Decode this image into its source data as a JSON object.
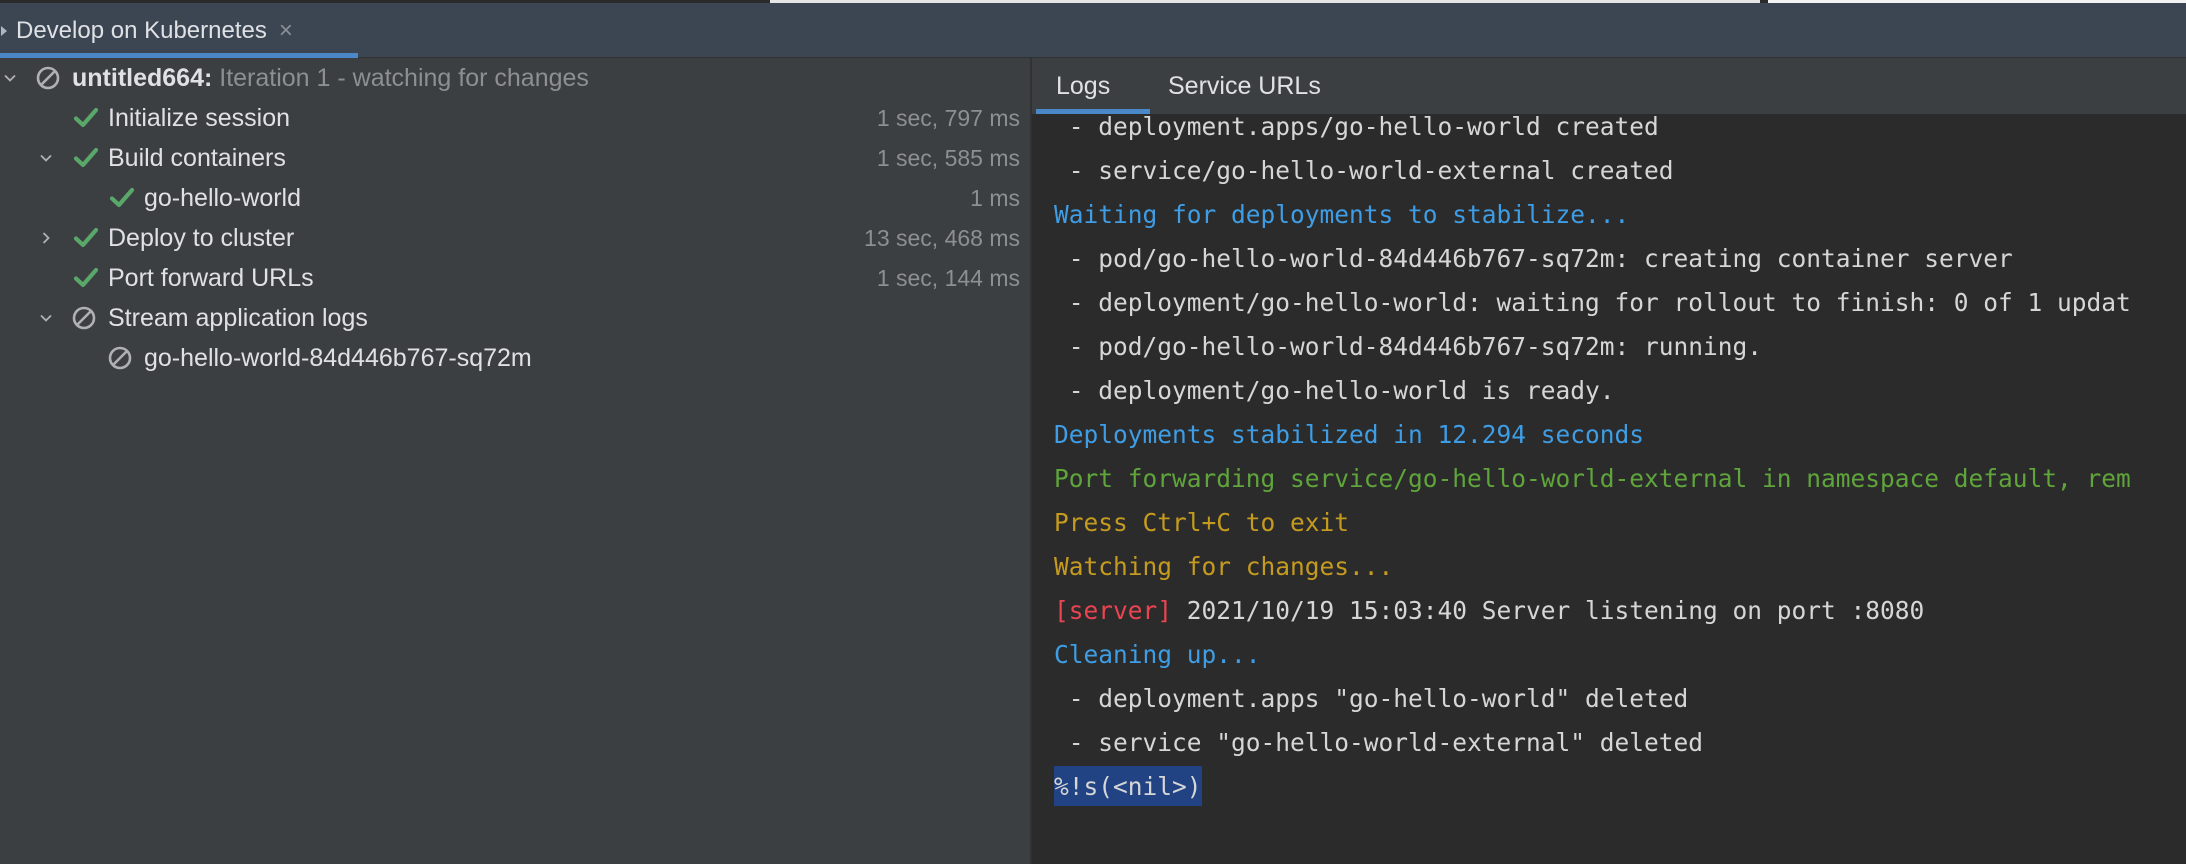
{
  "header": {
    "tab_title": "Develop on Kubernetes",
    "close_glyph": "×"
  },
  "tree": {
    "root": {
      "name": "untitled664:",
      "status": "Iteration 1 - watching for changes",
      "icon": "cancelled-icon"
    },
    "items": [
      {
        "label": "Initialize session",
        "duration": "1 sec, 797 ms",
        "icon": "check-icon"
      },
      {
        "label": "Build containers",
        "duration": "1 sec, 585 ms",
        "icon": "check-icon",
        "expanded": true
      },
      {
        "label": "go-hello-world",
        "duration": "1 ms",
        "icon": "check-icon"
      },
      {
        "label": "Deploy to cluster",
        "duration": "13 sec, 468 ms",
        "icon": "check-icon",
        "expanded": false
      },
      {
        "label": "Port forward URLs",
        "duration": "1 sec, 144 ms",
        "icon": "check-icon"
      },
      {
        "label": "Stream application logs",
        "duration": "",
        "icon": "cancelled-icon",
        "expanded": true
      },
      {
        "label": "go-hello-world-84d446b767-sq72m",
        "duration": "",
        "icon": "cancelled-icon"
      }
    ]
  },
  "log_tabs": {
    "logs": "Logs",
    "service_urls": "Service URLs"
  },
  "console": {
    "lines": [
      {
        "text": " - deployment.apps/go-hello-world created",
        "color": "white"
      },
      {
        "text": " - service/go-hello-world-external created",
        "color": "white"
      },
      {
        "text": "Waiting for deployments to stabilize...",
        "color": "blue"
      },
      {
        "text": " - pod/go-hello-world-84d446b767-sq72m: creating container server",
        "color": "white"
      },
      {
        "text": " - deployment/go-hello-world: waiting for rollout to finish: 0 of 1 updat",
        "color": "white"
      },
      {
        "text": " - pod/go-hello-world-84d446b767-sq72m: running.",
        "color": "white"
      },
      {
        "text": " - deployment/go-hello-world is ready.",
        "color": "white"
      },
      {
        "text": "Deployments stabilized in 12.294 seconds",
        "color": "blue"
      },
      {
        "text": "Port forwarding service/go-hello-world-external in namespace default, rem",
        "color": "green"
      },
      {
        "text": "Press Ctrl+C to exit",
        "color": "yellow"
      },
      {
        "text": "Watching for changes...",
        "color": "yellow"
      },
      {
        "prefix": "[server]",
        "text": " 2021/10/19 15:03:40 Server listening on port :8080",
        "color": "white"
      },
      {
        "text": "Cleaning up...",
        "color": "blue"
      },
      {
        "text": " - deployment.apps \"go-hello-world\" deleted",
        "color": "white"
      },
      {
        "text": " - service \"go-hello-world-external\" deleted",
        "color": "white"
      },
      {
        "text": "%!s(<nil>)",
        "color": "white",
        "selected": true
      }
    ]
  },
  "colors": {
    "check": "#59a869",
    "cancelled": "#afb1b3",
    "accent": "#4a88c7",
    "selection": "#214283"
  }
}
